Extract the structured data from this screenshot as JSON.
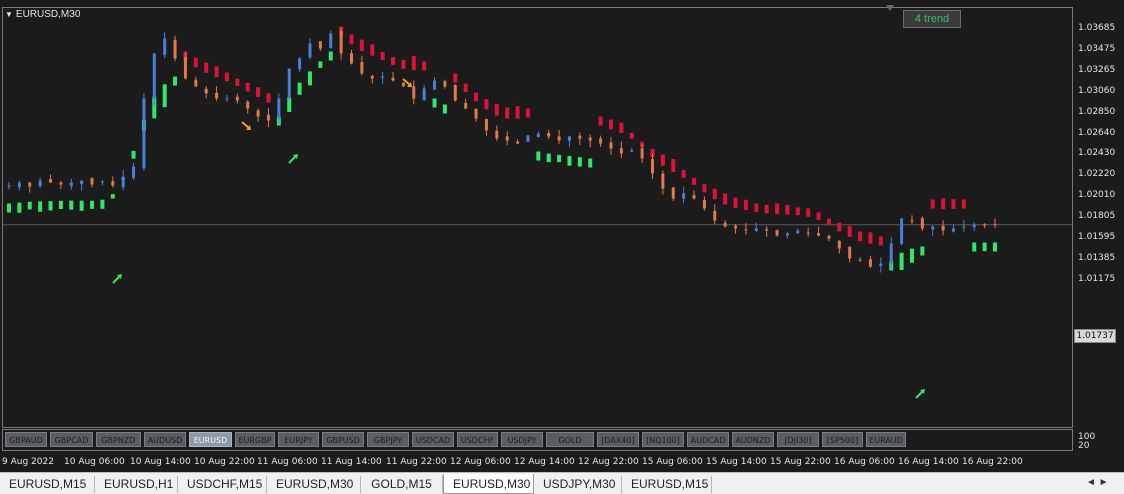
{
  "chart": {
    "title": "EURUSD,M30",
    "trend_label": "4 trend",
    "current_price": "1.01737",
    "y_ticks": [
      "1.03685",
      "1.03475",
      "1.03265",
      "1.03060",
      "1.02850",
      "1.02640",
      "1.02430",
      "1.02220",
      "1.02010",
      "1.01805",
      "1.01595",
      "1.01385",
      "1.01175"
    ],
    "x_ticks": [
      "9 Aug 2022",
      "10 Aug 06:00",
      "10 Aug 14:00",
      "10 Aug 22:00",
      "11 Aug 06:00",
      "11 Aug 14:00",
      "11 Aug 22:00",
      "12 Aug 06:00",
      "12 Aug 14:00",
      "12 Aug 22:00",
      "15 Aug 06:00",
      "15 Aug 14:00",
      "15 Aug 22:00",
      "16 Aug 06:00",
      "16 Aug 14:00",
      "16 Aug 22:00"
    ],
    "subwindow_ticks": [
      "100",
      "20"
    ],
    "colors": {
      "bull": "#4a7fd9",
      "bear": "#e07a4a",
      "up_band": "#2ee86a",
      "down_band": "#e0103a",
      "bg": "#1b1b1b",
      "grid": "#7a7a7a"
    }
  },
  "symbols": [
    "GBPAUD",
    "GBPCAD",
    "GBPNZD",
    "AUDUSD",
    "EURUSD",
    "EURGBP",
    "EURJPY",
    "GBPUSD",
    "GBPJPY",
    "USDCAD",
    "USDCHF",
    "USDJPY",
    "GOLD",
    "[DAX40]",
    "[NQ100]",
    "AUDCAD",
    "AUDNZD",
    "[DJI30]",
    "[SP500]",
    "EURAUD"
  ],
  "active_symbol": "EURUSD",
  "tabs": [
    "EURUSD,M15",
    "EURUSD,H1",
    "USDCHF,M15",
    "EURUSD,M30",
    "GOLD,M15",
    "EURUSD,M30",
    "USDJPY,M30",
    "EURUSD,M15"
  ],
  "active_tab_index": 5,
  "tab_scroll": "◄ ►",
  "chart_data": {
    "type": "candlestick",
    "title": "EURUSD,M30",
    "ylim": [
      1.0115,
      1.0378
    ],
    "x": [
      "9 Aug 2022",
      "10 Aug 06:00",
      "10 Aug 14:00",
      "10 Aug 22:00",
      "11 Aug 06:00",
      "11 Aug 14:00",
      "11 Aug 22:00",
      "12 Aug 06:00",
      "12 Aug 14:00",
      "12 Aug 22:00",
      "15 Aug 06:00",
      "15 Aug 14:00",
      "15 Aug 22:00",
      "16 Aug 06:00",
      "16 Aug 14:00",
      "16 Aug 22:00"
    ],
    "close_path": [
      [
        1.0213,
        1.0216,
        1.0212,
        1.0218,
        1.0216,
        1.0214
      ],
      [
        1.0216,
        1.0218,
        1.0214,
        1.0217,
        1.0213,
        1.0222
      ],
      [
        1.0232,
        1.03,
        1.0345,
        1.036,
        1.034,
        1.032
      ],
      [
        1.0312,
        1.0305,
        1.03,
        1.03,
        1.0298,
        1.029
      ],
      [
        1.0282,
        1.0278,
        1.03,
        1.033,
        1.034,
        1.0355
      ],
      [
        1.035,
        1.0365,
        1.0345,
        1.0335,
        1.0325,
        1.032
      ],
      [
        1.0322,
        1.0318,
        1.0312,
        1.03,
        1.031,
        1.0318
      ],
      [
        1.0312,
        1.0298,
        1.029,
        1.028,
        1.0268,
        1.026
      ],
      [
        1.0258,
        1.0255,
        1.0263,
        1.0265,
        1.0262,
        1.0258
      ],
      [
        1.0262,
        1.026,
        1.0258,
        1.0255,
        1.025,
        1.0245
      ],
      [
        1.0248,
        1.024,
        1.0225,
        1.021,
        1.02,
        1.0205
      ],
      [
        1.02,
        1.019,
        1.0178,
        1.0172,
        1.017,
        1.0168
      ],
      [
        1.017,
        1.0168,
        1.0163,
        1.0165,
        1.0168,
        1.0165
      ],
      [
        1.0163,
        1.016,
        1.015,
        1.014,
        1.0138,
        1.0132
      ],
      [
        1.0135,
        1.0155,
        1.018,
        1.0178,
        1.017,
        1.0172
      ],
      [
        1.0168,
        1.017,
        1.0172,
        1.0174,
        1.0173,
        1.0174
      ]
    ],
    "current_price": 1.01737,
    "grid": false
  }
}
